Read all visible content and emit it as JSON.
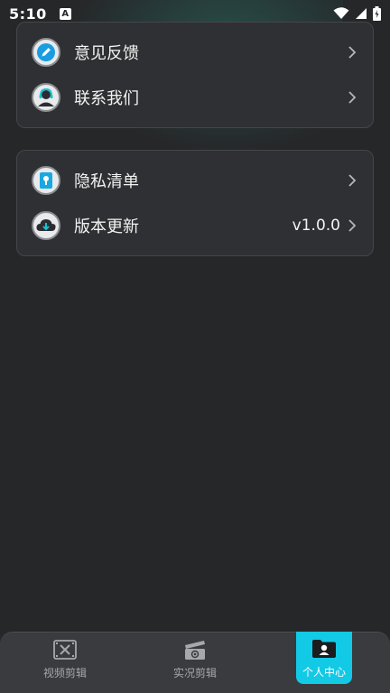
{
  "status_bar": {
    "time": "5:10",
    "notification_glyph": "A",
    "icons": [
      "wifi-icon",
      "signal-icon",
      "battery-icon"
    ]
  },
  "menu_groups": [
    {
      "items": [
        {
          "label": "意见反馈",
          "icon": "pencil-icon"
        },
        {
          "label": "联系我们",
          "icon": "support-agent-icon"
        }
      ]
    },
    {
      "items": [
        {
          "label": "隐私清单",
          "icon": "privacy-lock-icon"
        },
        {
          "label": "版本更新",
          "icon": "cloud-download-icon",
          "value": "v1.0.0"
        }
      ]
    }
  ],
  "tabbar": {
    "tabs": [
      {
        "label": "视频剪辑",
        "icon": "film-scissors-icon",
        "active": false
      },
      {
        "label": "实况剪辑",
        "icon": "clapper-icon",
        "active": false
      },
      {
        "label": "个人中心",
        "icon": "user-folder-icon",
        "active": true
      }
    ]
  },
  "colors": {
    "background": "#262729",
    "card": "#2f3033",
    "accent": "#12c9e6",
    "tabbar": "#3a3b3e"
  }
}
